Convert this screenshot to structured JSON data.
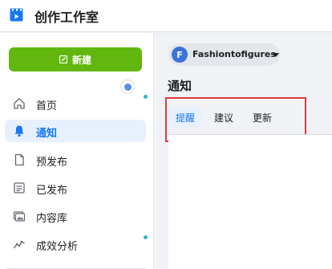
{
  "header": {
    "title": "创作工作室",
    "logo_icon": "studio-clapper-icon",
    "accent": "#1877f2"
  },
  "sidebar": {
    "new_button": {
      "label": "新建",
      "icon": "edit-icon",
      "color": "#62b70f"
    },
    "items": [
      {
        "label": "首页",
        "icon": "home-icon",
        "has_dot": true,
        "active": false
      },
      {
        "label": "通知",
        "icon": "bell-icon",
        "has_dot": false,
        "active": true
      },
      {
        "label": "预发布",
        "icon": "document-icon",
        "has_dot": false,
        "active": false
      },
      {
        "label": "已发布",
        "icon": "published-list-icon",
        "has_dot": false,
        "active": false
      },
      {
        "label": "内容库",
        "icon": "content-library-icon",
        "has_dot": false,
        "active": false
      },
      {
        "label": "成效分析",
        "icon": "analytics-icon",
        "has_dot": true,
        "active": false
      }
    ]
  },
  "main": {
    "account": {
      "avatar_letter": "F",
      "name": "Fashiontofigures"
    },
    "title": "通知",
    "tabs": [
      {
        "label": "提醒",
        "active": true
      },
      {
        "label": "建议",
        "active": false
      },
      {
        "label": "更新",
        "active": false
      }
    ]
  }
}
